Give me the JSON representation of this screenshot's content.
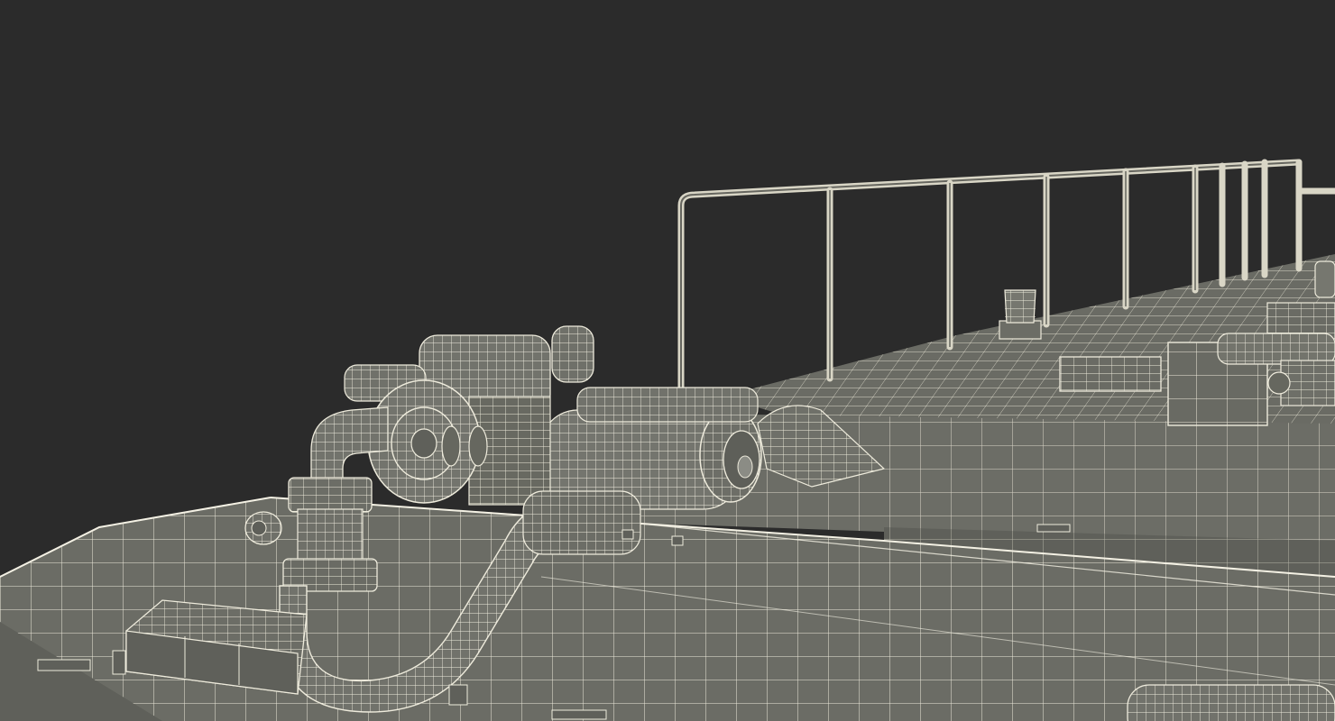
{
  "scene": {
    "subject": "wireframe-3d-model-ship-deck",
    "background_color": "#2b2b2b",
    "surface_color": "#6e6f68",
    "surface_dark_color": "#5e5f59",
    "wire_color": "#f2f0e2",
    "rail_color": "#c9c7b8"
  }
}
